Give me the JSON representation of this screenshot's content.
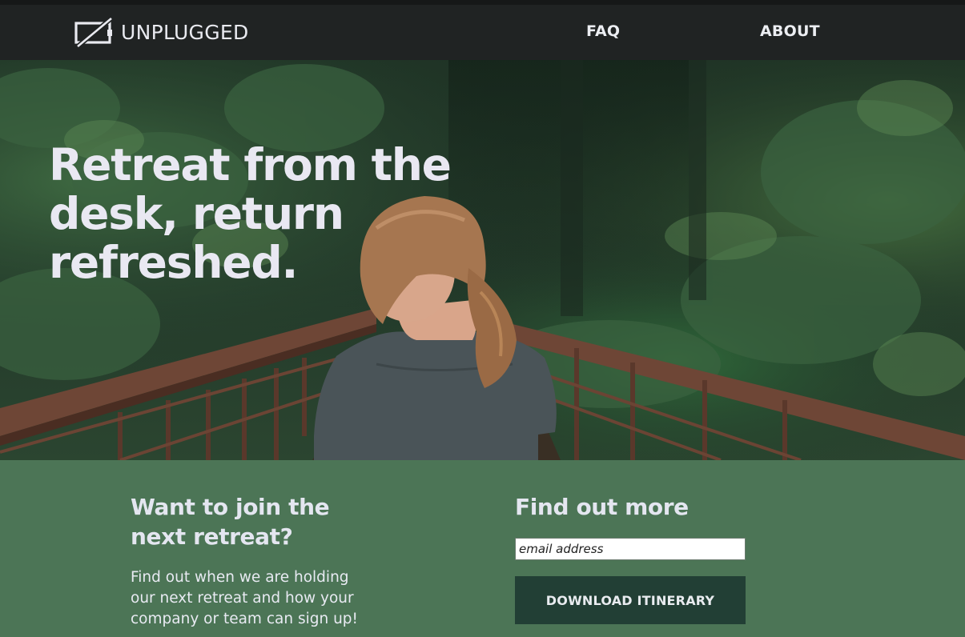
{
  "brand": {
    "name": "UNPLUGGED",
    "icon": "unplugged-logo-icon"
  },
  "nav": {
    "faq_label": "FAQ",
    "about_label": "ABOUT"
  },
  "hero": {
    "title": "Retreat from the desk, return refreshed.",
    "image": "woman-on-forest-bridge-photo"
  },
  "join": {
    "title": "Want to join the next retreat?",
    "text": "Find out when we are holding our next retreat and how your company or team can sign up!"
  },
  "more": {
    "title": "Find out more",
    "email_placeholder": "email address",
    "email_value": "",
    "download_label": "DOWNLOAD ITINERARY"
  },
  "colors": {
    "header_bg": "#202323",
    "band_bg": "#4c7556",
    "button_bg": "#223f35",
    "text_light": "#e9e8f2"
  }
}
